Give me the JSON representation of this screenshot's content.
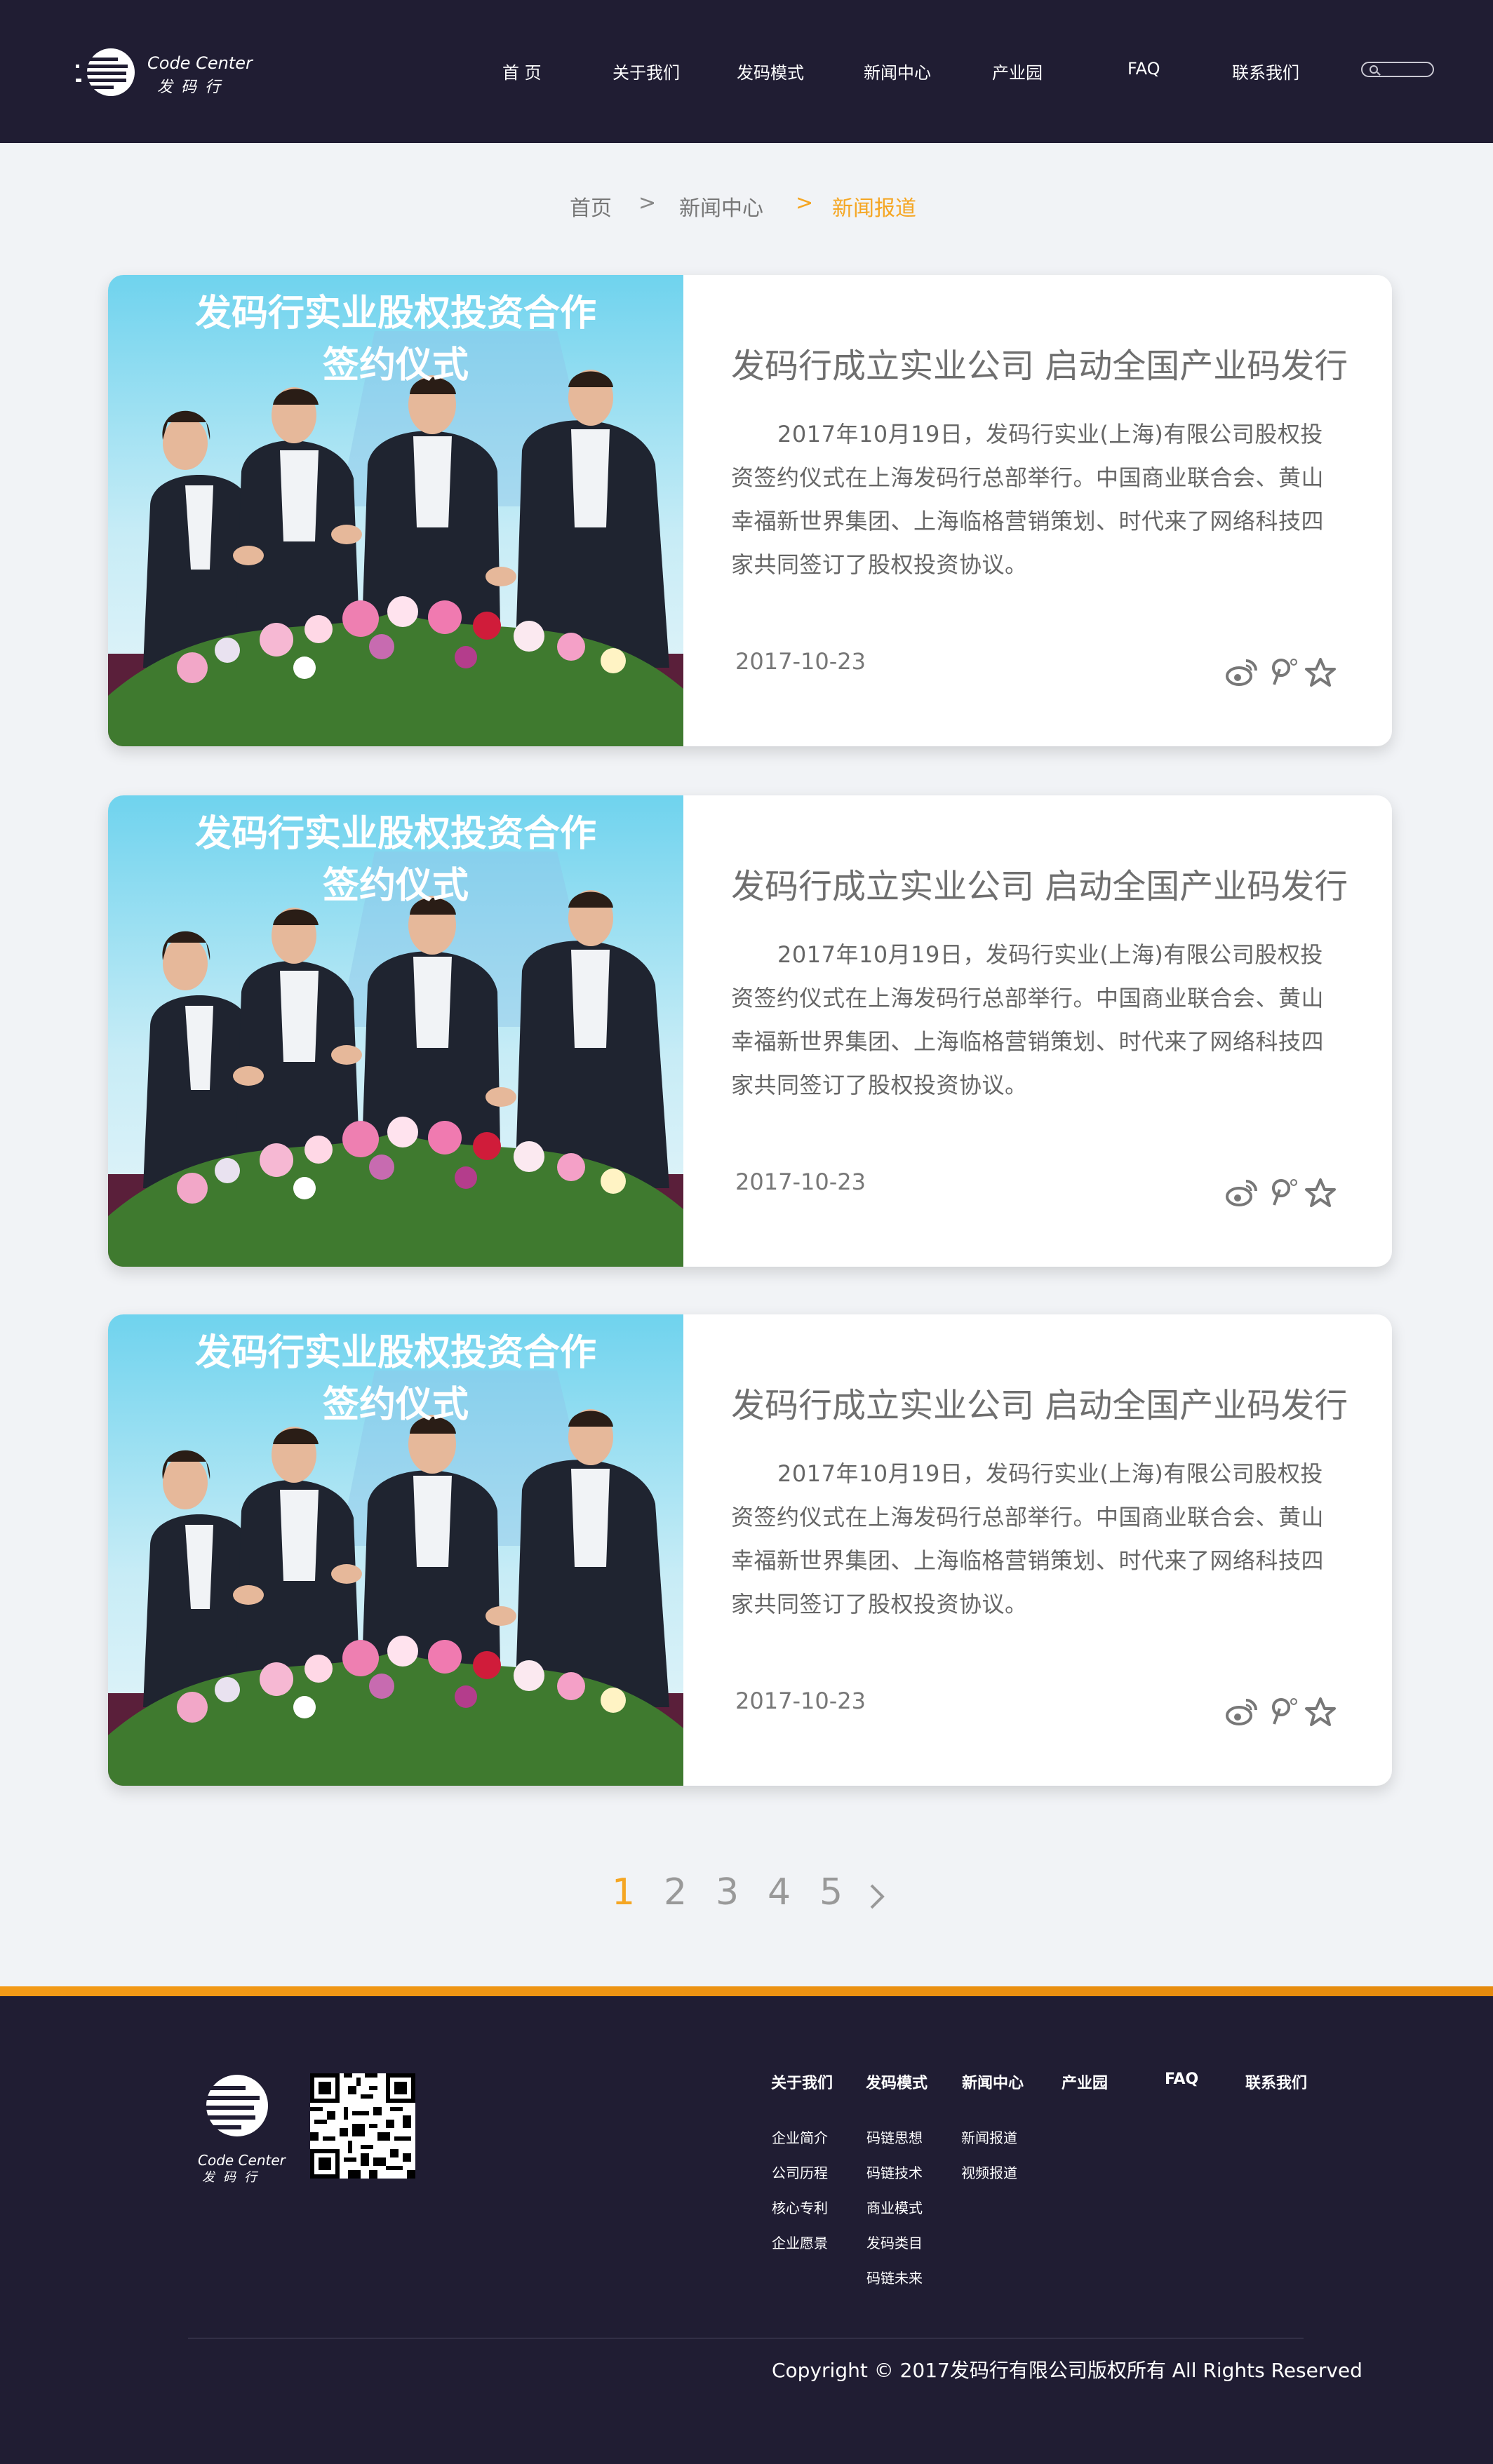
{
  "brand": {
    "name_en": "Code Center",
    "name_cn": "发码行"
  },
  "nav": [
    {
      "label": "首 页"
    },
    {
      "label": "关于我们"
    },
    {
      "label": "发码模式"
    },
    {
      "label": "新闻中心"
    },
    {
      "label": "产业园"
    },
    {
      "label": "FAQ"
    },
    {
      "label": "联系我们"
    }
  ],
  "search": {
    "placeholder": ""
  },
  "breadcrumb": {
    "home": "首页",
    "sep": ">",
    "section": "新闻中心",
    "current": "新闻报道"
  },
  "photo": {
    "banner_line1": "发码行实业股权投资合作",
    "banner_line2": "签约仪式"
  },
  "articles": [
    {
      "title": "发码行成立实业公司 启动全国产业码发行",
      "body": "2017年10月19日，发码行实业(上海)有限公司股权投资签约仪式在上海发码行总部举行。中国商业联合会、黄山幸福新世界集团、上海临格营销策划、时代来了网络科技四家共同签订了股权投资协议。",
      "date": "2017-10-23"
    },
    {
      "title": "发码行成立实业公司 启动全国产业码发行",
      "body": "2017年10月19日，发码行实业(上海)有限公司股权投资签约仪式在上海发码行总部举行。中国商业联合会、黄山幸福新世界集团、上海临格营销策划、时代来了网络科技四家共同签订了股权投资协议。",
      "date": "2017-10-23"
    },
    {
      "title": "发码行成立实业公司 启动全国产业码发行",
      "body": "2017年10月19日，发码行实业(上海)有限公司股权投资签约仪式在上海发码行总部举行。中国商业联合会、黄山幸福新世界集团、上海临格营销策划、时代来了网络科技四家共同签订了股权投资协议。",
      "date": "2017-10-23"
    }
  ],
  "share_icons": [
    "weibo-icon",
    "pinterest-icon",
    "star-icon"
  ],
  "pagination": {
    "pages": [
      "1",
      "2",
      "3",
      "4",
      "5"
    ],
    "current": "1",
    "next": "›"
  },
  "footer": {
    "columns": [
      {
        "title": "关于我们",
        "links": [
          "企业简介",
          "公司历程",
          "核心专利",
          "企业愿景"
        ]
      },
      {
        "title": "发码模式",
        "links": [
          "码链思想",
          "码链技术",
          "商业模式",
          "发码类目",
          "码链未来"
        ]
      },
      {
        "title": "新闻中心",
        "links": [
          "新闻报道",
          "视频报道"
        ]
      },
      {
        "title": "产业园",
        "links": []
      },
      {
        "title": "FAQ",
        "links": []
      },
      {
        "title": "联系我们",
        "links": []
      }
    ],
    "copyright": "Copyright  ©  2017发码行有限公司版权所有 All Rights Reserved"
  },
  "colors": {
    "header_bg": "#201d33",
    "accent": "#f5a623",
    "page_bg": "#f1f3f6"
  }
}
